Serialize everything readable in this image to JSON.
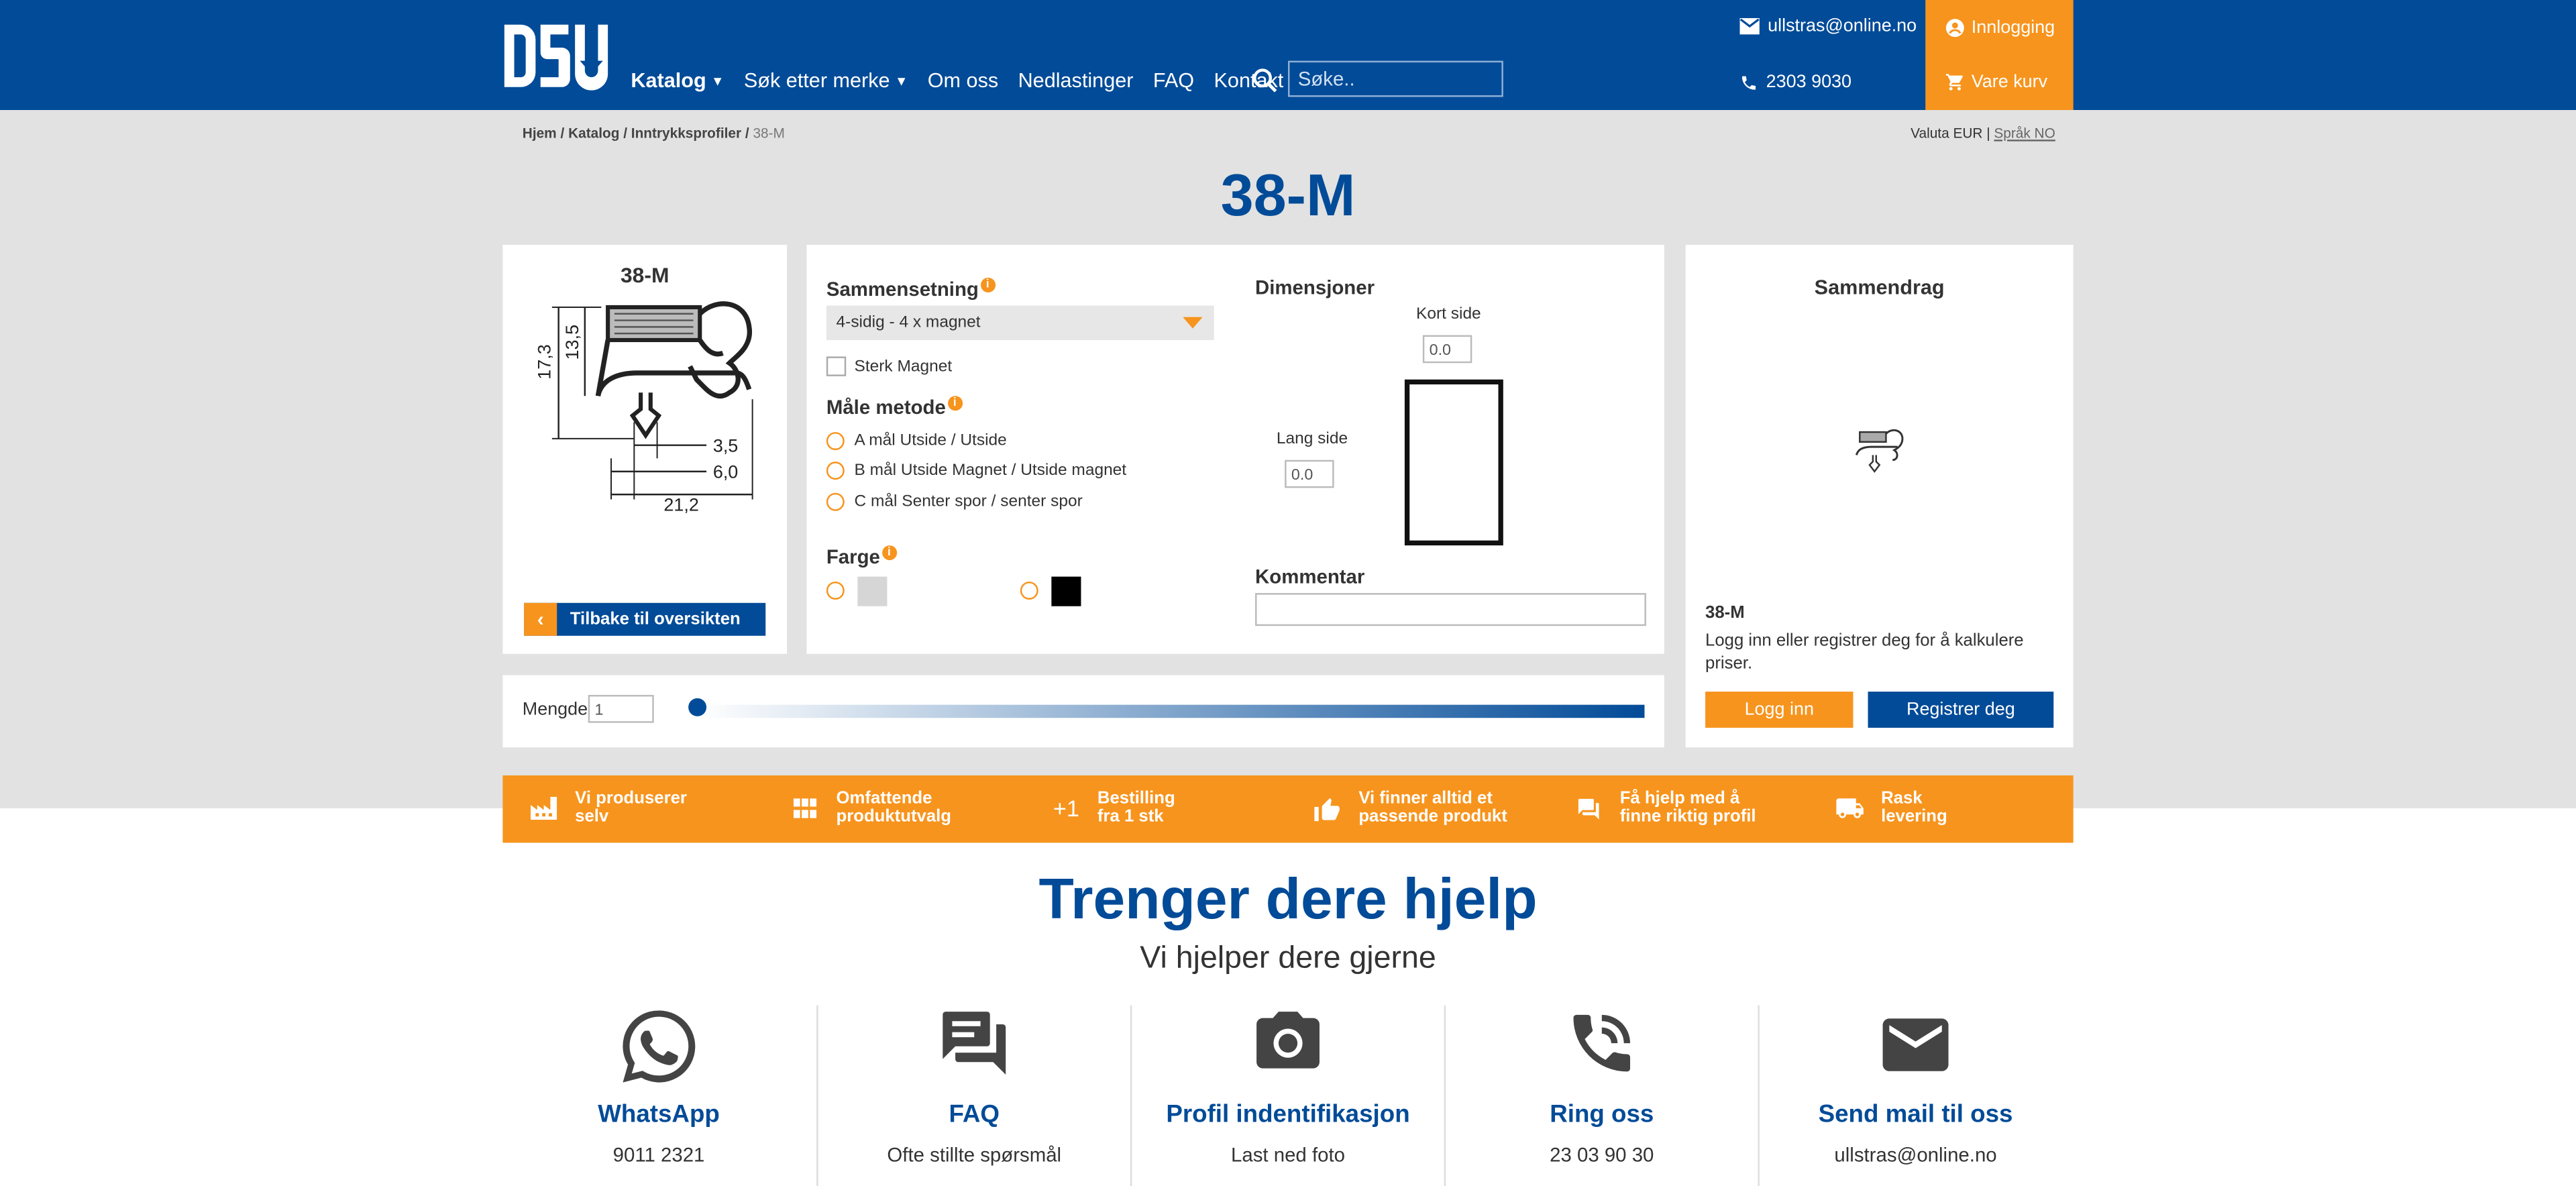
{
  "header": {
    "nav": [
      "Katalog",
      "Søk etter merke",
      "Om oss",
      "Nedlastinger",
      "FAQ",
      "Kontakt"
    ],
    "search_placeholder": "Søke..",
    "email": "ullstras@online.no",
    "phone": "2303 9030",
    "login": "Innlogging",
    "cart": "Vare kurv"
  },
  "breadcrumb": {
    "home": "Hjem",
    "catalog": "Katalog",
    "category": "Inntrykksprofiler",
    "current": "38-M"
  },
  "locale": {
    "currency_text": "Valuta EUR",
    "language_text": "Språk NO"
  },
  "product": {
    "title": "38-M",
    "image_title": "38-M",
    "dims": [
      "17,3",
      "13,5",
      "3,5",
      "6,0",
      "21,2"
    ],
    "back_label": "Tilbake til oversikten"
  },
  "config": {
    "composition_label": "Sammensetning",
    "composition_value": "4-sidig - 4 x magnet",
    "strong_magnet": "Sterk Magnet",
    "method_label": "Måle metode",
    "methods": [
      "A mål Utside / Utside",
      "B mål Utside Magnet / Utside magnet",
      "C mål Senter spor / senter spor"
    ],
    "color_label": "Farge",
    "colors": [
      "#d6d6d6",
      "#000000"
    ],
    "dimensions_label": "Dimensjoner",
    "short_side": "Kort side",
    "short_value": "0.0",
    "long_side": "Lang side",
    "long_value": "0.0",
    "comment_label": "Kommentar"
  },
  "quantity": {
    "label": "Mengde",
    "value": "1"
  },
  "summary": {
    "title": "Sammendrag",
    "product": "38-M",
    "text": "Logg inn eller registrer deg for å kalkulere priser.",
    "login_btn": "Logg inn",
    "register_btn": "Registrer deg"
  },
  "features": [
    {
      "line1": "Vi produserer",
      "line2": "selv",
      "icon": "factory-icon"
    },
    {
      "line1": "Omfattende",
      "line2": "produktutvalg",
      "icon": "grid-icon"
    },
    {
      "line1": "Bestilling",
      "line2": "fra 1 stk",
      "icon": "plus-one-icon"
    },
    {
      "line1": "Vi finner alltid et",
      "line2": "passende produkt",
      "icon": "thumbs-up-icon"
    },
    {
      "line1": "Få hjelp med å",
      "line2": "finne riktig profil",
      "icon": "chat-icon"
    },
    {
      "line1": "Rask",
      "line2": "levering",
      "icon": "truck-icon"
    }
  ],
  "help": {
    "title": "Trenger dere hjelp",
    "subtitle": "Vi hjelper dere gjerne",
    "items": [
      {
        "title": "WhatsApp",
        "sub": "9011 2321",
        "icon": "whatsapp-icon"
      },
      {
        "title": "FAQ",
        "sub": "Ofte stillte spørsmål",
        "icon": "forum-icon"
      },
      {
        "title": "Profil indentifikasjon",
        "sub": "Last ned foto",
        "icon": "camera-icon"
      },
      {
        "title": "Ring oss",
        "sub": "23 03 90 30",
        "icon": "phone-callback-icon"
      },
      {
        "title": "Send mail til oss",
        "sub": "ullstras@online.no",
        "icon": "mail-icon"
      }
    ]
  },
  "colors": {
    "brand_blue": "#024b98",
    "accent_orange": "#f7941d"
  }
}
